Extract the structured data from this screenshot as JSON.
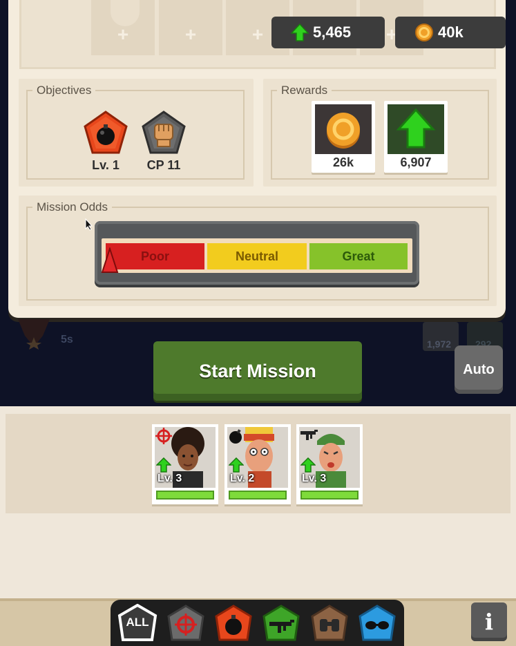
{
  "resources": {
    "upgrade_points": "5,465",
    "coins": "40k"
  },
  "objectives": {
    "title": "Objectives",
    "items": [
      {
        "icon": "bomb-icon",
        "label": "Lv. 1",
        "color": "#e8471c"
      },
      {
        "icon": "fist-icon",
        "label": "CP 11",
        "color": "#5b5b5b"
      }
    ]
  },
  "rewards": {
    "title": "Rewards",
    "items": [
      {
        "icon": "coin-icon",
        "value": "26k"
      },
      {
        "icon": "up-arrow-icon",
        "value": "6,907"
      }
    ]
  },
  "mission_odds": {
    "title": "Mission Odds",
    "segments": [
      {
        "label": "Poor",
        "color": "#d72020",
        "text_color": "#8a1010"
      },
      {
        "label": "Neutral",
        "color": "#f2cc1e",
        "text_color": "#7a5a00"
      },
      {
        "label": "Great",
        "color": "#86c22a",
        "text_color": "#2c5a0a"
      }
    ],
    "indicator": "Poor"
  },
  "background": {
    "timer": "5s",
    "stat_1": "1,972",
    "stat_2": "292"
  },
  "actions": {
    "start_mission": "Start Mission",
    "auto": "Auto"
  },
  "squad": [
    {
      "level": "Lv. 3",
      "role_icon": "crosshair-icon",
      "health": 1.0
    },
    {
      "level": "Lv. 2",
      "role_icon": "bomb-icon",
      "health": 1.0
    },
    {
      "level": "Lv. 3",
      "role_icon": "rifle-icon",
      "health": 1.0
    }
  ],
  "filters": {
    "all_label": "ALL",
    "items": [
      {
        "icon": "crosshair-icon",
        "color": "#6b6b6b"
      },
      {
        "icon": "bomb-icon",
        "color": "#e8471c"
      },
      {
        "icon": "rifle-icon",
        "color": "#3ea528"
      },
      {
        "icon": "binoculars-icon",
        "color": "#8c6344"
      },
      {
        "icon": "goggles-icon",
        "color": "#2c9be0"
      }
    ]
  },
  "info_label": "i",
  "colors": {
    "parchment": "#f4ecdd",
    "start_green": "#4e7a2c",
    "upgrade_green": "#2fd11e",
    "coin_orange": "#f0a028"
  }
}
